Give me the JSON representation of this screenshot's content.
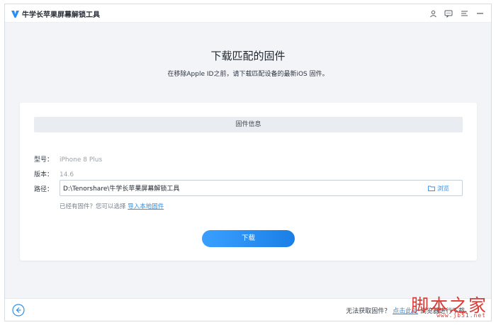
{
  "app": {
    "title": "牛学长苹果屏幕解锁工具"
  },
  "titlebar": {
    "icons": [
      "user-icon",
      "feedback-icon",
      "menu-icon",
      "minimize-icon"
    ]
  },
  "page": {
    "heading": "下载匹配的固件",
    "subheading": "在移除Apple ID之前，请下载匹配设备的最新iOS 固件。"
  },
  "firmware": {
    "section_title": "固件信息",
    "model_label": "型号：",
    "model_value": "iPhone 8 Plus",
    "version_label": "版本：",
    "version_value": "14.6",
    "path_label": "路径：",
    "path_value": "D:\\Tenorshare\\牛学长苹果屏幕解锁工具",
    "browse_label": "浏览",
    "hint_text": "已经有固件？您可以选择 ",
    "hint_link": "导入本地固件"
  },
  "actions": {
    "download_label": "下载"
  },
  "footer": {
    "help_text": "无法获取固件？ ",
    "help_link": "点击此处",
    "help_suffix": " 浏览器进行下载。"
  },
  "watermark": {
    "text": "脚本之家",
    "url": "www.jb51.net"
  },
  "colors": {
    "accent": "#2f8fe8",
    "button": "#1a7fe6",
    "background": "#f2f4f7",
    "watermark": "#d93b35"
  }
}
